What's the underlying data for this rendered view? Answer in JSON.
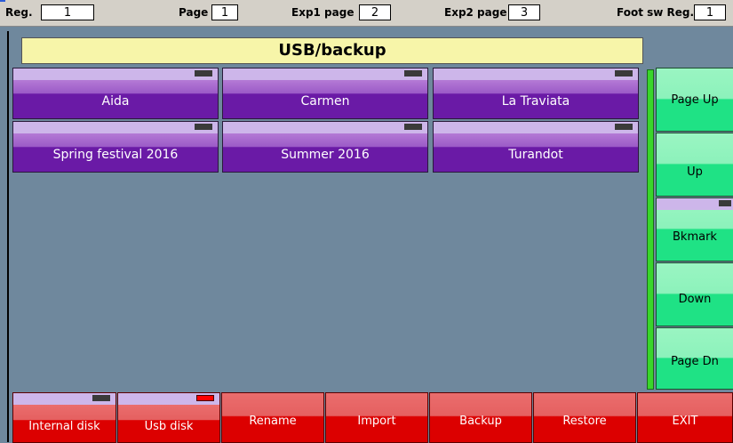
{
  "topbar": {
    "reg_label": "Reg.",
    "reg_value": "1",
    "page_label": "Page",
    "page_value": "1",
    "exp1_label": "Exp1 page",
    "exp1_value": "2",
    "exp2_label": "Exp2 page",
    "exp2_value": "3",
    "foot_label": "Foot sw Reg.",
    "foot_value": "1"
  },
  "title": "USB/backup",
  "library": [
    {
      "label": "Aida"
    },
    {
      "label": "Carmen"
    },
    {
      "label": "La Traviata"
    },
    {
      "label": "Spring festival 2016"
    },
    {
      "label": "Summer 2016"
    },
    {
      "label": "Turandot"
    }
  ],
  "nav": {
    "page_up": "Page Up",
    "up": "Up",
    "bkmark": "Bkmark",
    "down": "Down",
    "page_dn": "Page Dn"
  },
  "bottom": {
    "internal_disk": "Internal disk",
    "usb_disk": "Usb disk",
    "rename": "Rename",
    "import": "Import",
    "backup": "Backup",
    "restore": "Restore",
    "exit": "EXIT"
  },
  "colors": {
    "background": "#6f889d",
    "title_bg": "#f7f5a9",
    "library_button": "#6a1aa6",
    "nav_button": "#1fe285",
    "action_button": "#dc0000",
    "usb_indicator_active": "#ff0000"
  }
}
